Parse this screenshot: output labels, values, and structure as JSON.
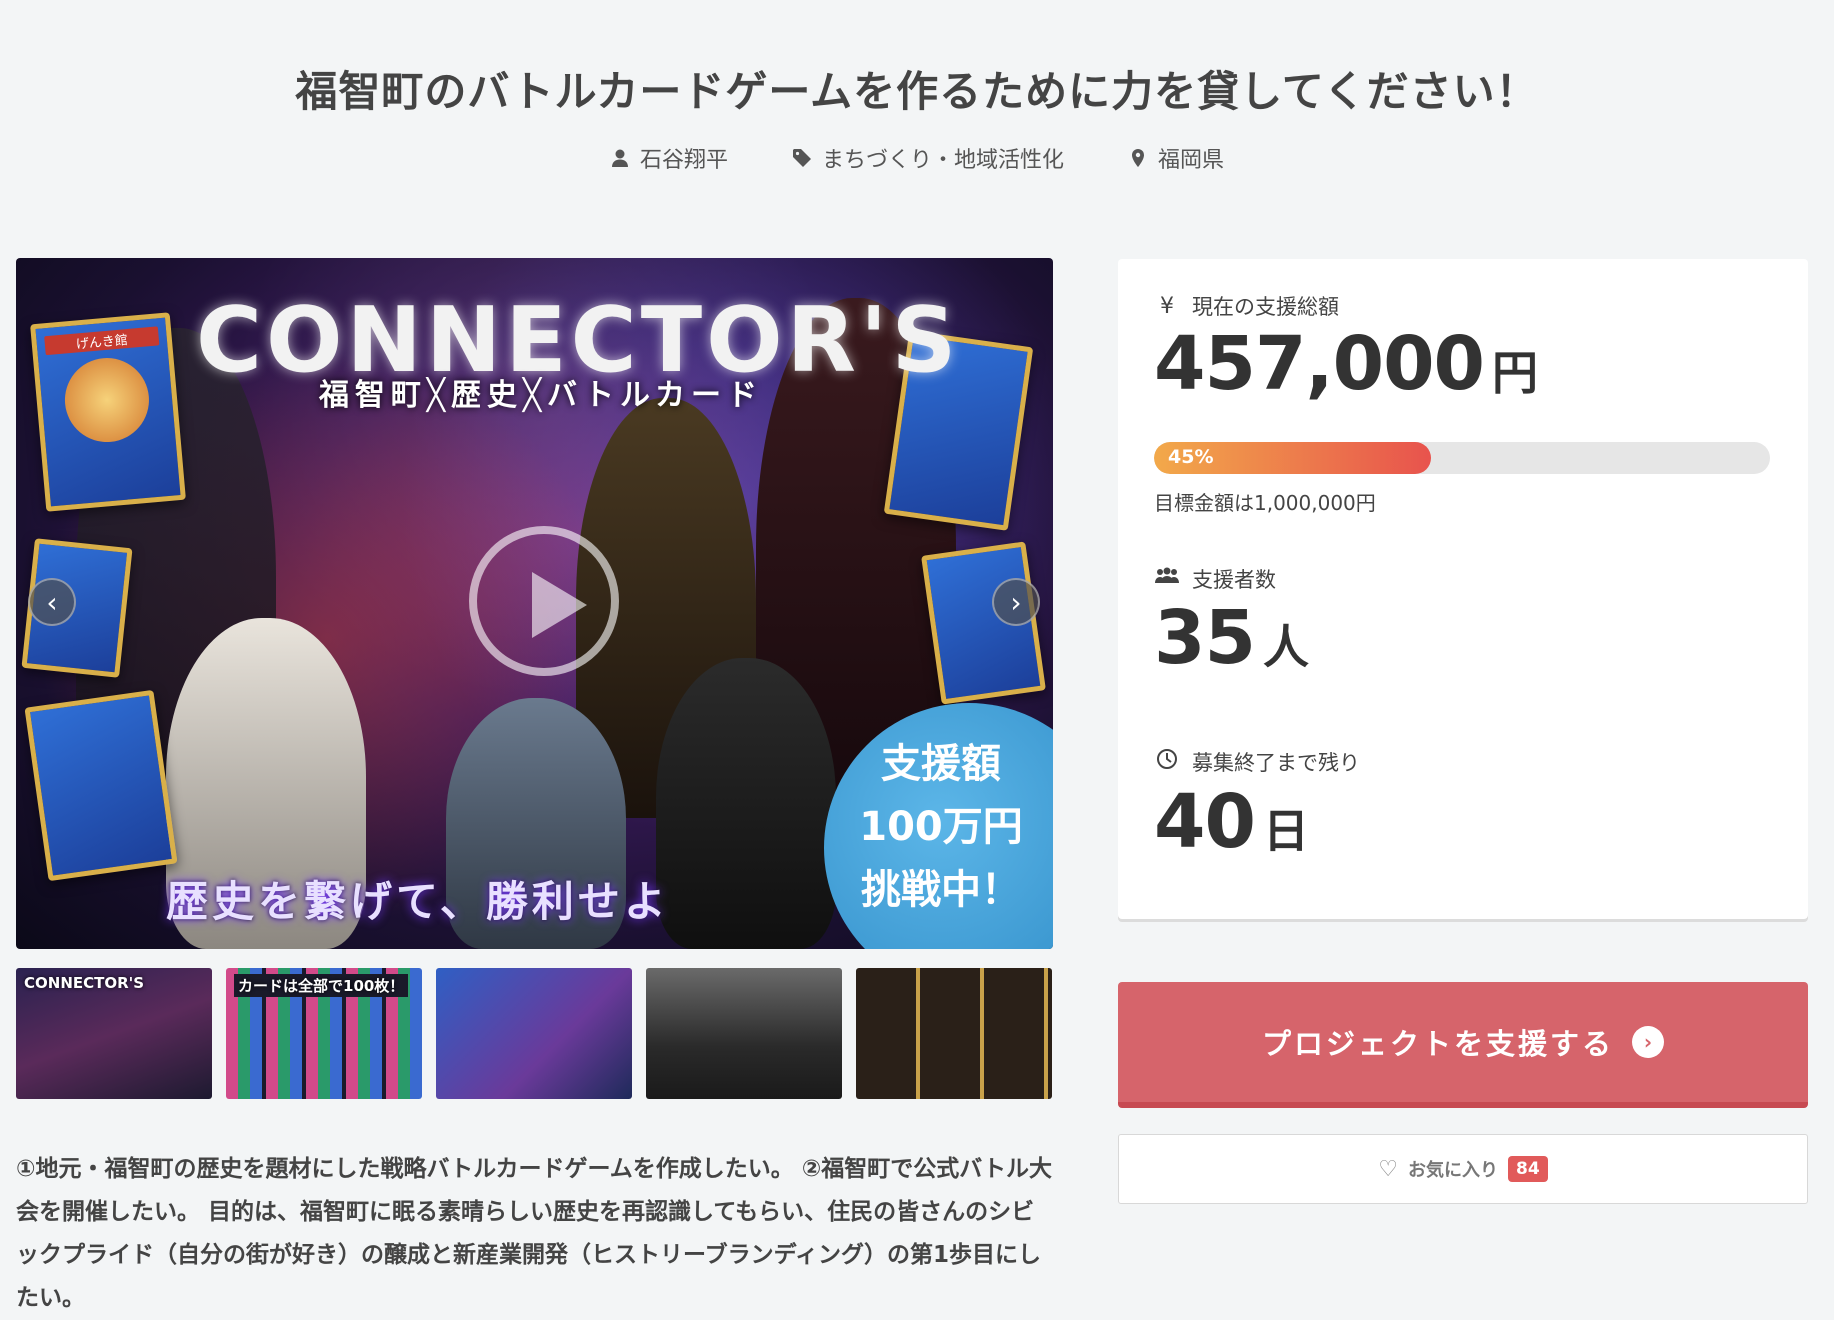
{
  "header": {
    "title": "福智町のバトルカードゲームを作るために力を貸してください！",
    "owner": "石谷翔平",
    "category": "まちづくり・地域活性化",
    "location": "福岡県"
  },
  "hero": {
    "logo": "CONNECTOR'S",
    "subtitle": "福智町╳歴史╳バトルカード",
    "tagline": "歴史を繋げて、勝利せよ",
    "badge_line1": "支援額",
    "badge_line2": "100万円",
    "badge_line3": "挑戦中！",
    "card_label_1": "げんき館"
  },
  "thumbnails": [
    {
      "label": "CONNECTOR'S"
    },
    {
      "label": "カードは全部で100枚！"
    },
    {
      "label": ""
    },
    {
      "label": ""
    },
    {
      "label": ""
    }
  ],
  "description": "①地元・福智町の歴史を題材にした戦略バトルカードゲームを作成したい。 ②福智町で公式バトル大会を開催したい。 目的は、福智町に眠る素晴らしい歴史を再認識してもらい、住民の皆さんのシビックプライド（自分の街が好き）の醸成と新産業開発（ヒストリーブランディング）の第1歩目にしたい。",
  "stats": {
    "amount_label": "現在の支援総額",
    "amount_value": "457,000",
    "amount_unit": "円",
    "progress_percent": 45,
    "progress_label": "45%",
    "goal_text": "目標金額は1,000,000円",
    "supporters_label": "支援者数",
    "supporters_value": "35",
    "supporters_unit": "人",
    "remaining_label": "募集終了まで残り",
    "remaining_value": "40",
    "remaining_unit": "日"
  },
  "actions": {
    "support_label": "プロジェクトを支援する",
    "favorite_label": "お気に入り",
    "favorite_count": "84"
  },
  "colors": {
    "accent": "#d6646b",
    "progress_start": "#f2a94a",
    "progress_end": "#e8534d",
    "badge": "#e15a5a"
  }
}
